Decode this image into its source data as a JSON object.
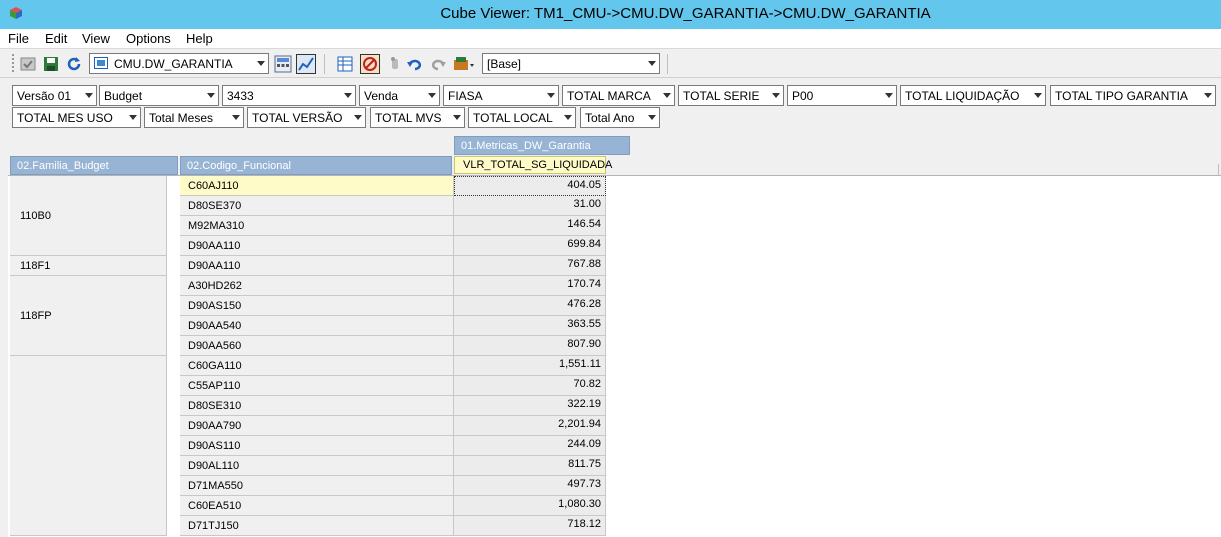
{
  "window": {
    "title": "Cube Viewer: TM1_CMU->CMU.DW_GARANTIA->CMU.DW_GARANTIA",
    "icon": "cube-icon"
  },
  "menu": [
    "File",
    "Edit",
    "View",
    "Options",
    "Help"
  ],
  "toolbar": {
    "cube_select": "CMU.DW_GARANTIA",
    "view_select": "[Base]",
    "icons": [
      "recalc-check-icon",
      "save-icon",
      "refresh-icon",
      "calculator-icon",
      "chart-icon",
      "grid-icon",
      "no-icon",
      "hand-icon",
      "undo-icon",
      "redo-icon",
      "export-icon"
    ]
  },
  "filters_row1": [
    "Versão 01",
    "Budget",
    "3433",
    "Venda",
    "FIASA",
    "TOTAL MARCA",
    "TOTAL SERIE",
    "P00",
    "TOTAL LIQUIDAÇÃO",
    "TOTAL TIPO GARANTIA"
  ],
  "filters_row2": [
    "TOTAL MES USO",
    "Total Meses",
    "TOTAL VERSÃO",
    "TOTAL MVS",
    "TOTAL LOCAL",
    "Total Ano"
  ],
  "column_dim": "01.Metricas_DW_Garantia",
  "column_member": "VLR_TOTAL_SG_LIQUIDADA",
  "row_dims": [
    "02.Familia_Budget",
    "02.Codigo_Funcional"
  ],
  "families": [
    {
      "name": "110B0",
      "rows": 4
    },
    {
      "name": "118F1",
      "rows": 1
    },
    {
      "name": "118FP",
      "rows": 4
    },
    {
      "name": "",
      "rows": 9
    }
  ],
  "rows": [
    {
      "code": "C60AJ110",
      "value": "404.05"
    },
    {
      "code": "D80SE370",
      "value": "31.00"
    },
    {
      "code": "M92MA310",
      "value": "146.54"
    },
    {
      "code": "D90AA110",
      "value": "699.84"
    },
    {
      "code": "D90AA110",
      "value": "767.88"
    },
    {
      "code": "A30HD262",
      "value": "170.74"
    },
    {
      "code": "D90AS150",
      "value": "476.28"
    },
    {
      "code": "D90AA540",
      "value": "363.55"
    },
    {
      "code": "D90AA560",
      "value": "807.90"
    },
    {
      "code": "C60GA110",
      "value": "1,551.11"
    },
    {
      "code": "C55AP110",
      "value": "70.82"
    },
    {
      "code": "D80SE310",
      "value": "322.19"
    },
    {
      "code": "D90AA790",
      "value": "2,201.94"
    },
    {
      "code": "D90AS110",
      "value": "244.09"
    },
    {
      "code": "D90AL110",
      "value": "811.75"
    },
    {
      "code": "D71MA550",
      "value": "497.73"
    },
    {
      "code": "C60EA510",
      "value": "1,080.30"
    },
    {
      "code": "D71TJ150",
      "value": "718.12"
    }
  ]
}
